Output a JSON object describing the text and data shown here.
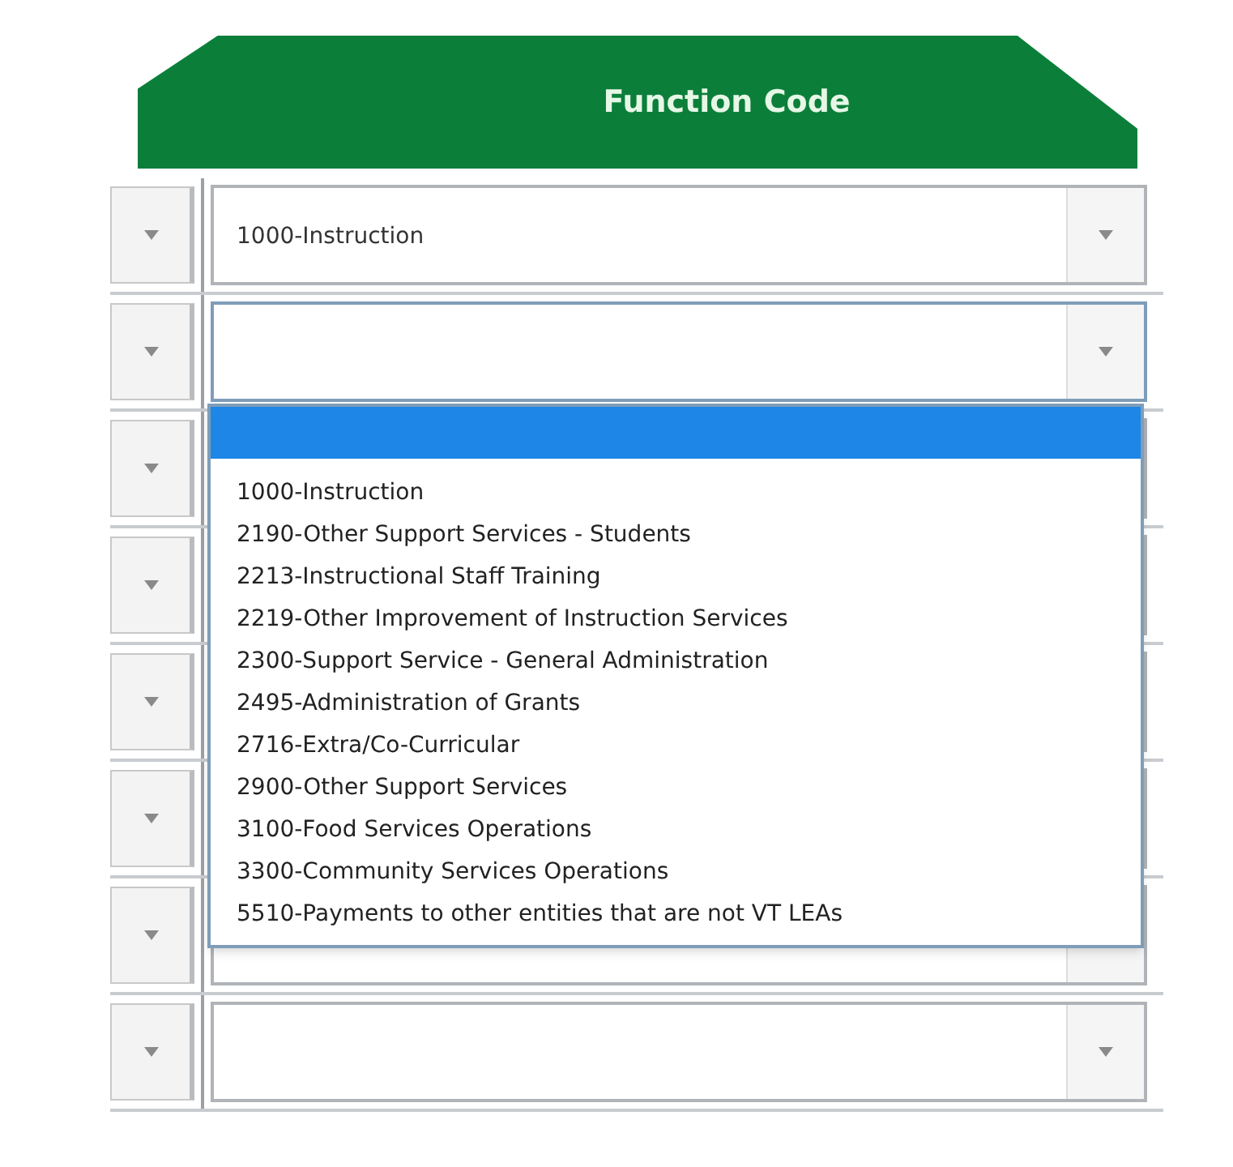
{
  "header": {
    "title": "Function Code"
  },
  "rows": [
    {
      "function_code": "1000-Instruction",
      "expanded": false
    },
    {
      "expanded": true
    },
    {
      "expanded": false
    },
    {
      "expanded": false
    },
    {
      "expanded": false
    },
    {
      "expanded": false
    },
    {
      "expanded": false
    },
    {
      "expanded": false
    }
  ],
  "dropdown": {
    "options": [
      {
        "selected": true
      },
      {
        "label": "1000-Instruction",
        "selected": false
      },
      {
        "label": "2190-Other Support Services - Students",
        "selected": false
      },
      {
        "label": "2213-Instructional Staff Training",
        "selected": false
      },
      {
        "label": "2219-Other Improvement of Instruction Services",
        "selected": false
      },
      {
        "label": "2300-Support Service - General Administration",
        "selected": false
      },
      {
        "label": "2495-Administration of Grants",
        "selected": false
      },
      {
        "label": "2716-Extra/Co-Curricular",
        "selected": false
      },
      {
        "label": "2900-Other Support Services",
        "selected": false
      },
      {
        "label": "3100-Food Services Operations",
        "selected": false
      },
      {
        "label": "3300-Community Services Operations",
        "selected": false
      },
      {
        "label": "5510-Payments to other entities that are not VT LEAs",
        "selected": false
      }
    ]
  }
}
